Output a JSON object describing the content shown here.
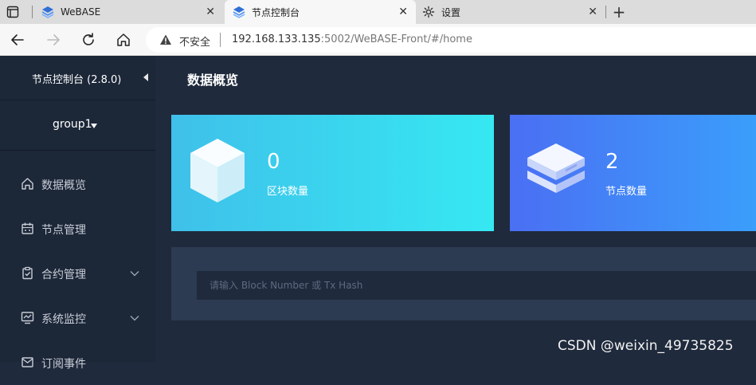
{
  "browser": {
    "tabs": [
      {
        "title": "WeBASE",
        "active": false
      },
      {
        "title": "节点控制台",
        "active": true
      },
      {
        "title": "设置",
        "active": false
      }
    ],
    "close_glyph": "✕",
    "newtab_glyph": "+",
    "security_label": "不安全",
    "url_host": "192.168.133.135",
    "url_rest": ":5002/WeBASE-Front/#/home"
  },
  "sidebar": {
    "title": "节点控制台 (2.8.0)",
    "group": "group1",
    "items": [
      {
        "label": "数据概览",
        "icon": "home-icon",
        "expandable": false
      },
      {
        "label": "节点管理",
        "icon": "calendar-icon",
        "expandable": false
      },
      {
        "label": "合约管理",
        "icon": "clipboard-icon",
        "expandable": true
      },
      {
        "label": "系统监控",
        "icon": "monitor-chart-icon",
        "expandable": true
      },
      {
        "label": "订阅事件",
        "icon": "subscribe-icon",
        "expandable": false
      }
    ]
  },
  "main": {
    "title": "数据概览",
    "cards": [
      {
        "value": "0",
        "label": "区块数量",
        "icon": "cube-icon"
      },
      {
        "value": "2",
        "label": "节点数量",
        "icon": "server-stack-icon"
      }
    ],
    "search": {
      "placeholder": "请输入 Block Number 或 Tx Hash",
      "value": ""
    }
  },
  "watermark": "CSDN @weixin_49735825",
  "colors": {
    "sidebar_bg": "#1c2738",
    "main_bg": "#1f2a3c",
    "card_blocks_from": "#3fc0ea",
    "card_blocks_to": "#36e8f2",
    "card_nodes_from": "#4a6ff3",
    "card_nodes_to": "#3aa0fb"
  }
}
